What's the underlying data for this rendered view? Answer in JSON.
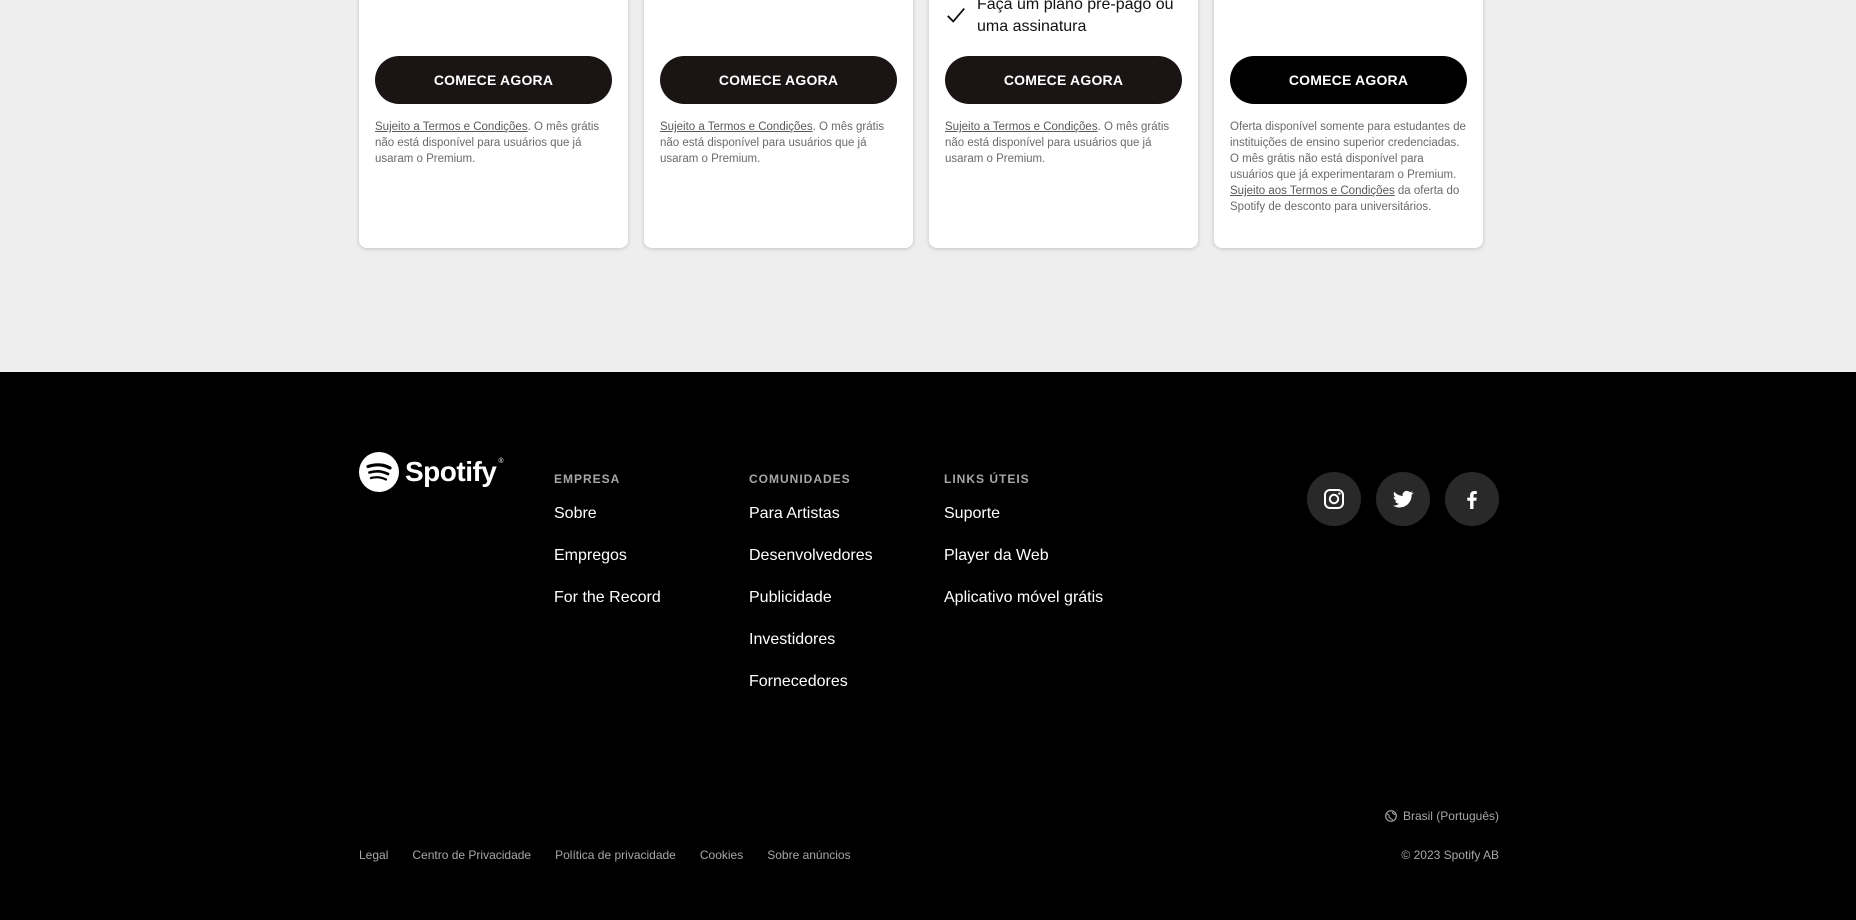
{
  "plans": [
    {
      "cta_label": "COMECE AGORA",
      "terms_link": "Sujeito a Termos e Condições",
      "terms_text": ". O mês grátis não está disponível para usuários que já usaram o Premium."
    },
    {
      "cta_label": "COMECE AGORA",
      "terms_link": "Sujeito a Termos e Condições",
      "terms_text": ". O mês grátis não está disponível para usuários que já usaram o Premium."
    },
    {
      "feature_line1": "Faça um plano pré-pago ou",
      "feature_line2": "uma assinatura",
      "cta_label": "COMECE AGORA",
      "terms_link": "Sujeito a Termos e Condições",
      "terms_text": ". O mês grátis não está disponível para usuários que já usaram o Premium."
    },
    {
      "cta_label": "COMECE AGORA",
      "terms_prefix": "Oferta disponível somente para estudantes de instituições de ensino superior credenciadas. O mês grátis não está disponível para usuários que já experimentaram o Premium. ",
      "terms_link": "Sujeito aos Termos e Condições",
      "terms_text": " da oferta do Spotify de desconto para universitários."
    }
  ],
  "footer": {
    "logo_text": "Spotify",
    "logo_mark": "®",
    "columns": [
      {
        "heading": "EMPRESA",
        "links": [
          "Sobre",
          "Empregos",
          "For the Record"
        ]
      },
      {
        "heading": "COMUNIDADES",
        "links": [
          "Para Artistas",
          "Desenvolvedores",
          "Publicidade",
          "Investidores",
          "Fornecedores"
        ]
      },
      {
        "heading": "LINKS ÚTEIS",
        "links": [
          "Suporte",
          "Player da Web",
          "Aplicativo móvel grátis"
        ]
      }
    ],
    "social_icons": [
      "instagram-icon",
      "twitter-icon",
      "facebook-icon"
    ],
    "region": "Brasil (Português)",
    "legal_links": [
      "Legal",
      "Centro de Privacidade",
      "Política de privacidade",
      "Cookies",
      "Sobre anúncios"
    ],
    "copyright": "© 2023 Spotify AB"
  },
  "colors": {
    "page_bg": "#eeeeee",
    "card_bg": "#ffffff",
    "cta_bg": "#1a1414",
    "footer_bg": "#000000",
    "footer_muted": "#a7a7a7",
    "social_bg": "#292929"
  }
}
